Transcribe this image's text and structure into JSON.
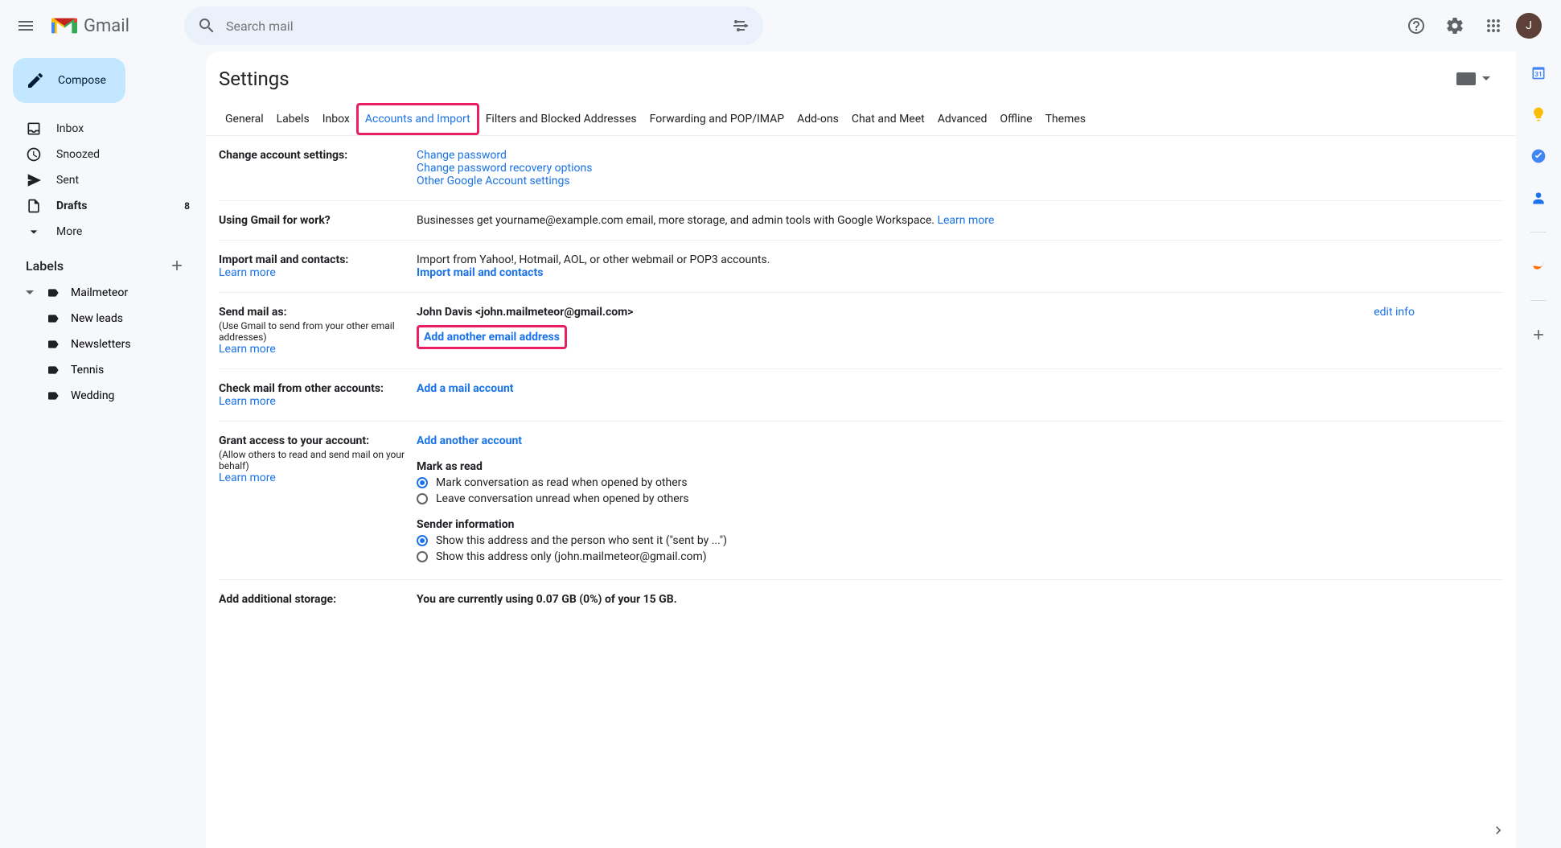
{
  "header": {
    "logo_text": "Gmail",
    "search_placeholder": "Search mail",
    "avatar_initial": "J"
  },
  "sidebar": {
    "compose": "Compose",
    "items": [
      {
        "label": "Inbox",
        "count": ""
      },
      {
        "label": "Snoozed",
        "count": ""
      },
      {
        "label": "Sent",
        "count": ""
      },
      {
        "label": "Drafts",
        "count": "8"
      },
      {
        "label": "More",
        "count": ""
      }
    ],
    "labels_header": "Labels",
    "labels": [
      {
        "label": "Mailmeteor",
        "sub": false,
        "arrow": true
      },
      {
        "label": "New leads",
        "sub": true,
        "arrow": false
      },
      {
        "label": "Newsletters",
        "sub": false,
        "arrow": false
      },
      {
        "label": "Tennis",
        "sub": false,
        "arrow": false
      },
      {
        "label": "Wedding",
        "sub": false,
        "arrow": false
      }
    ]
  },
  "settings": {
    "title": "Settings",
    "tabs": [
      "General",
      "Labels",
      "Inbox",
      "Accounts and Import",
      "Filters and Blocked Addresses",
      "Forwarding and POP/IMAP",
      "Add-ons",
      "Chat and Meet",
      "Advanced",
      "Offline",
      "Themes"
    ],
    "change_account": {
      "title": "Change account settings:",
      "links": [
        "Change password",
        "Change password recovery options",
        "Other Google Account settings"
      ]
    },
    "using_gmail_work": {
      "title": "Using Gmail for work?",
      "text": "Businesses get yourname@example.com email, more storage, and admin tools with Google Workspace. ",
      "learn_more": "Learn more"
    },
    "import_mail": {
      "title": "Import mail and contacts:",
      "learn_more": "Learn more",
      "text": "Import from Yahoo!, Hotmail, AOL, or other webmail or POP3 accounts.",
      "action": "Import mail and contacts"
    },
    "send_mail_as": {
      "title": "Send mail as:",
      "sub": "(Use Gmail to send from your other email addresses)",
      "learn_more": "Learn more",
      "identity": "John Davis <john.mailmeteor@gmail.com>",
      "edit_info": "edit info",
      "add_another": "Add another email address"
    },
    "check_mail": {
      "title": "Check mail from other accounts:",
      "learn_more": "Learn more",
      "action": "Add a mail account"
    },
    "grant_access": {
      "title": "Grant access to your account:",
      "sub": "(Allow others to read and send mail on your behalf)",
      "learn_more": "Learn more",
      "action": "Add another account",
      "mark_read_title": "Mark as read",
      "mark_read_opt1": "Mark conversation as read when opened by others",
      "mark_read_opt2": "Leave conversation unread when opened by others",
      "sender_info_title": "Sender information",
      "sender_opt1": "Show this address and the person who sent it (\"sent by ...\")",
      "sender_opt2": "Show this address only (john.mailmeteor@gmail.com)"
    },
    "storage": {
      "title": "Add additional storage:",
      "text": "You are currently using 0.07 GB (0%) of your 15 GB."
    }
  }
}
